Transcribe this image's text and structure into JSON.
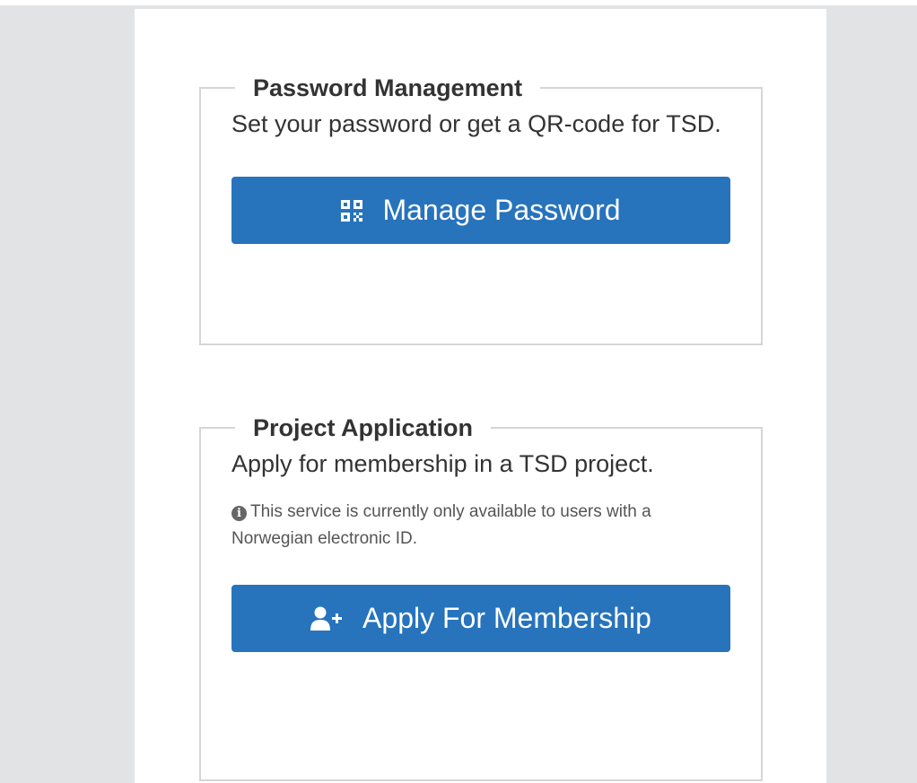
{
  "password_management": {
    "legend": "Password Management",
    "description": "Set your password or get a QR-code for TSD.",
    "button_label": "Manage Password",
    "button_icon": "qr-code-icon"
  },
  "project_application": {
    "legend": "Project Application",
    "description": "Apply for membership in a TSD project.",
    "note": "This service is currently only available to users with a Norwegian electronic ID.",
    "note_icon": "info-circle-icon",
    "button_label": "Apply For Membership",
    "button_icon": "user-plus-icon"
  },
  "colors": {
    "accent": "#2773bc",
    "page_background": "#e2e3e5",
    "panel_background": "#ffffff",
    "border": "#d6d6d6",
    "text": "#333333"
  }
}
